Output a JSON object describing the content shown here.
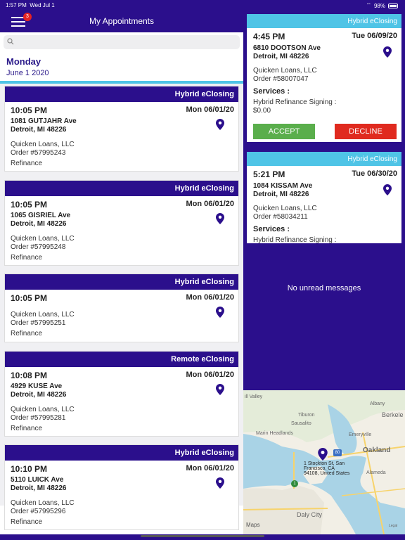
{
  "status": {
    "time": "1:57 PM",
    "day": "Wed Jul 1",
    "battery": "98%"
  },
  "header": {
    "title": "My Appointments",
    "badge": "3"
  },
  "search": {
    "placeholder": ""
  },
  "section": {
    "day": "Monday",
    "date": "June 1 2020"
  },
  "appointments": [
    {
      "type": "Hybrid eClosing",
      "time": "10:05 PM",
      "date": "Mon 06/01/20",
      "addr1": "1081 GUTJAHR Ave",
      "addr2": "Detroit, MI 48226",
      "company": "Quicken Loans, LLC",
      "order": "Order #57995243",
      "kind": "Refinance"
    },
    {
      "type": "Hybrid eClosing",
      "time": "10:05 PM",
      "date": "Mon 06/01/20",
      "addr1": "1065 GISRIEL Ave",
      "addr2": "Detroit, MI 48226",
      "company": "Quicken Loans, LLC",
      "order": "Order #57995248",
      "kind": "Refinance"
    },
    {
      "type": "Hybrid eClosing",
      "time": "10:05 PM",
      "date": "Mon 06/01/20",
      "addr1": "",
      "addr2": "",
      "company": "Quicken Loans, LLC",
      "order": "Order #57995251",
      "kind": "Refinance"
    },
    {
      "type": "Remote eClosing",
      "time": "10:08 PM",
      "date": "Mon 06/01/20",
      "addr1": "4929 KUSE Ave",
      "addr2": "Detroit, MI 48226",
      "company": "Quicken Loans, LLC",
      "order": "Order #57995281",
      "kind": "Refinance"
    },
    {
      "type": "Hybrid eClosing",
      "time": "10:10 PM",
      "date": "Mon 06/01/20",
      "addr1": "5110 LUICK Ave",
      "addr2": "Detroit, MI 48226",
      "company": "Quicken Loans, LLC",
      "order": "Order #57995296",
      "kind": "Refinance"
    }
  ],
  "requests": [
    {
      "type": "Hybrid eClosing",
      "time": "4:45 PM",
      "date": "Tue 06/09/20",
      "addr1": "6810 DOOTSON Ave",
      "addr2": "Detroit, MI 48226",
      "company": "Quicken Loans, LLC",
      "order": "Order #58007047",
      "services_label": "Services :",
      "service1": "Hybrid Refinance Signing :",
      "service2": "$0.00",
      "accept": "ACCEPT",
      "decline": "DECLINE"
    },
    {
      "type": "Hybrid eClosing",
      "time": "5:21 PM",
      "date": "Tue 06/30/20",
      "addr1": "1084 KISSAM Ave",
      "addr2": "Detroit, MI 48226",
      "company": "Quicken Loans, LLC",
      "order": "Order #58034211",
      "services_label": "Services :",
      "service1": "Hybrid Refinance Signing :"
    }
  ],
  "messages": {
    "empty": "No unread messages"
  },
  "map": {
    "labels": [
      "ill Valley",
      "Tiburon",
      "Albany",
      "Berkele",
      "Sausalito",
      "Marin Headlands",
      "Emeryville",
      "Oakland",
      "Alameda",
      "Daly City",
      "1 Stockton St, San",
      "Francisco, CA",
      "94108, United States"
    ],
    "brand": "Maps",
    "legal": "Legal",
    "shield1": "80",
    "shield2": "1",
    "water": "#a9d3e6",
    "land": "#f2efe6",
    "pin_color": "#2b0f8c"
  },
  "colors": {
    "primary": "#2b0f8c",
    "cyan": "#4fc4e6",
    "accept": "#5aae4c",
    "decline": "#e02a1f"
  }
}
